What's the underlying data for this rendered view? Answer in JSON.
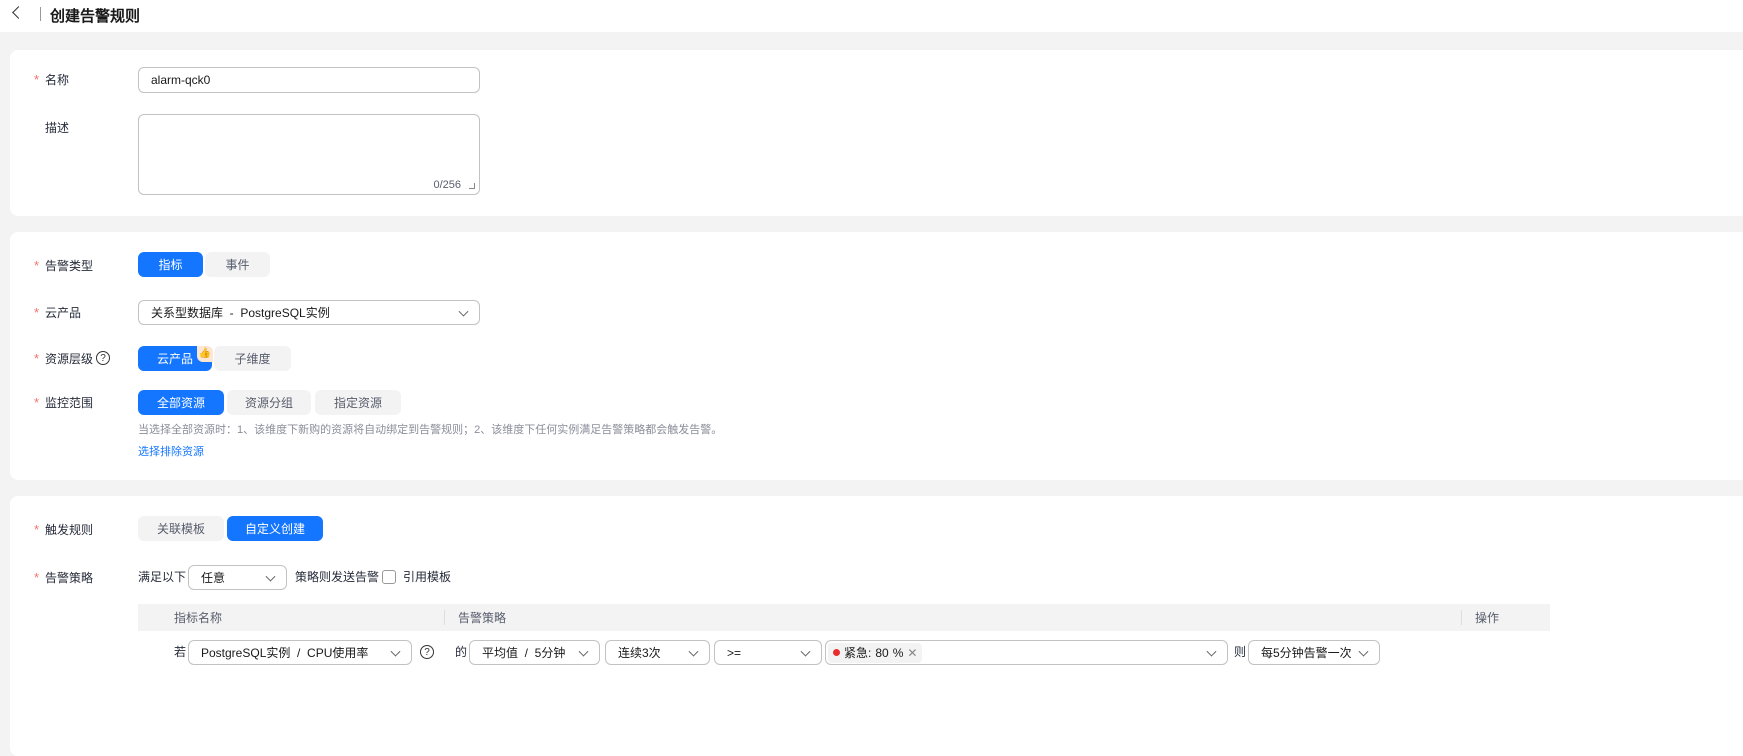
{
  "header": {
    "title": "创建告警规则"
  },
  "basic": {
    "name_label": "名称",
    "name_value": "alarm-qck0",
    "desc_label": "描述",
    "desc_counter": "0/256"
  },
  "config": {
    "alarm_type_label": "告警类型",
    "alarm_type_options": [
      "指标",
      "事件"
    ],
    "product_label": "云产品",
    "product_value": "关系型数据库  -  PostgreSQL实例",
    "level_label": "资源层级",
    "level_options": [
      "云产品",
      "子维度"
    ],
    "scope_label": "监控范围",
    "scope_options": [
      "全部资源",
      "资源分组",
      "指定资源"
    ],
    "scope_hint": "当选择全部资源时：1、该维度下新购的资源将自动绑定到告警规则；2、该维度下任何实例满足告警策略都会触发告警。",
    "exclude_link": "选择排除资源"
  },
  "trigger": {
    "rule_label": "触发规则",
    "rule_options": [
      "关联模板",
      "自定义创建"
    ],
    "policy_label": "告警策略",
    "prefix": "满足以下",
    "match_value": "任意",
    "suffix": "策略则发送告警",
    "use_template": "引用模板",
    "table": {
      "headers": [
        "指标名称",
        "告警策略",
        "操作"
      ],
      "row": {
        "if": "若",
        "metric": "PostgreSQL实例  /  CPU使用率",
        "of": "的",
        "stat": "平均值  /  5分钟",
        "times": "连续3次",
        "op": ">=",
        "level": "紧急:",
        "value": "80",
        "unit": "%",
        "then": "则",
        "notify": "每5分钟告警一次"
      }
    }
  },
  "colors": {
    "primary": "#1476ff",
    "danger": "#e82d2d"
  }
}
